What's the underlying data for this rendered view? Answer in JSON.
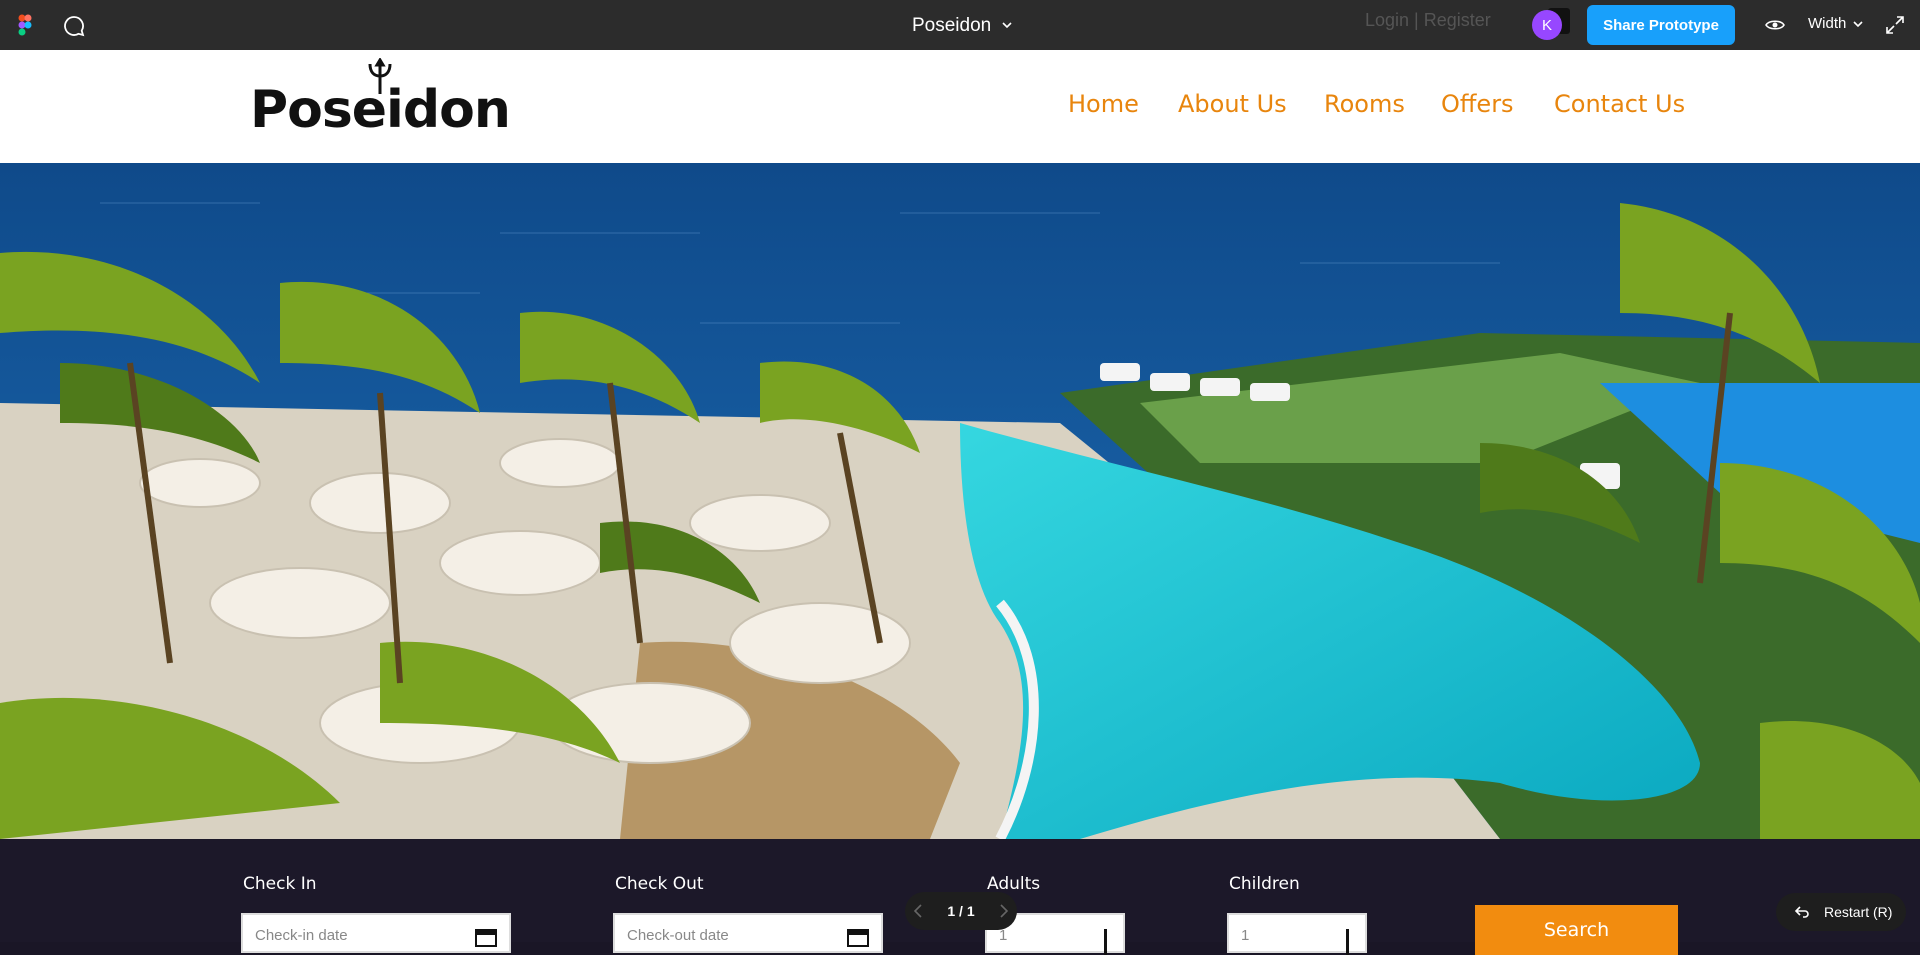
{
  "figma": {
    "file_title": "Poseidon",
    "avatar_initial": "K",
    "share_label": "Share Prototype",
    "width_label": "Width",
    "pager_label": "1 / 1",
    "restart_label": "Restart (R)",
    "accent": "#18a0fb"
  },
  "site": {
    "logo_text": "Poseidon",
    "login_text": "Login | Register",
    "nav": [
      "Home",
      "About Us",
      "Rooms",
      "Offers",
      "Contact Us"
    ],
    "accent": "#e8850d"
  },
  "booking": {
    "check_in_label": "Check In",
    "check_in_placeholder": "Check-in date",
    "check_out_label": "Check Out",
    "check_out_placeholder": "Check-out date",
    "adults_label": "Adults",
    "adults_value": "1",
    "children_label": "Children",
    "children_value": "1",
    "search_label": "Search",
    "search_color": "#f28c0f"
  }
}
